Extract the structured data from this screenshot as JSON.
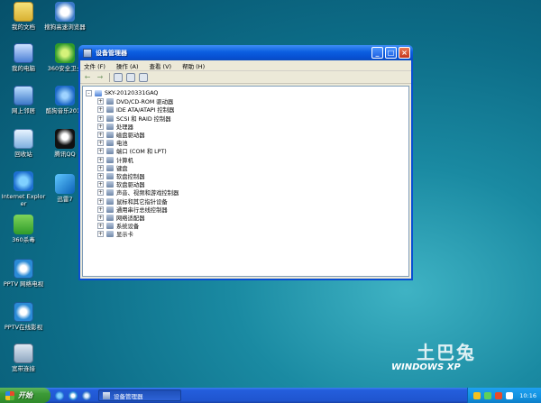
{
  "desktop": {
    "icons": [
      {
        "label": "我的文档"
      },
      {
        "label": "搜狗高速浏览器"
      },
      {
        "label": "我的电脑"
      },
      {
        "label": "360安全卫士"
      },
      {
        "label": "网上邻居"
      },
      {
        "label": "酷狗音乐2013"
      },
      {
        "label": "回收站"
      },
      {
        "label": "腾讯QQ"
      },
      {
        "label": "Internet Explorer"
      },
      {
        "label": "迅雷7"
      },
      {
        "label": "360杀毒"
      },
      {
        "label": "PPTV 网络电视"
      },
      {
        "label": "PPTV在线影视"
      },
      {
        "label": "宽带连接"
      }
    ]
  },
  "window": {
    "title": "设备管理器",
    "menu": [
      "文件 (F)",
      "操作 (A)",
      "查看 (V)",
      "帮助 (H)"
    ],
    "toolbar": {
      "back": "←",
      "forward": "→"
    },
    "tree": {
      "root": "SKY-20120331GAQ",
      "items": [
        "DVD/CD-ROM 驱动器",
        "IDE ATA/ATAPI 控制器",
        "SCSI 和 RAID 控制器",
        "处理器",
        "磁盘驱动器",
        "电池",
        "端口 (COM 和 LPT)",
        "计算机",
        "键盘",
        "软盘控制器",
        "软盘驱动器",
        "声音、视频和游戏控制器",
        "鼠标和其它指针设备",
        "通用串行总线控制器",
        "网络适配器",
        "系统设备",
        "显示卡"
      ],
      "expander": "+"
    }
  },
  "logo": {
    "big": "土巴兔",
    "small": "WINDOWS XP"
  },
  "taskbar": {
    "start": "开始",
    "task_button": "设备管理器",
    "clock": "10:16"
  }
}
